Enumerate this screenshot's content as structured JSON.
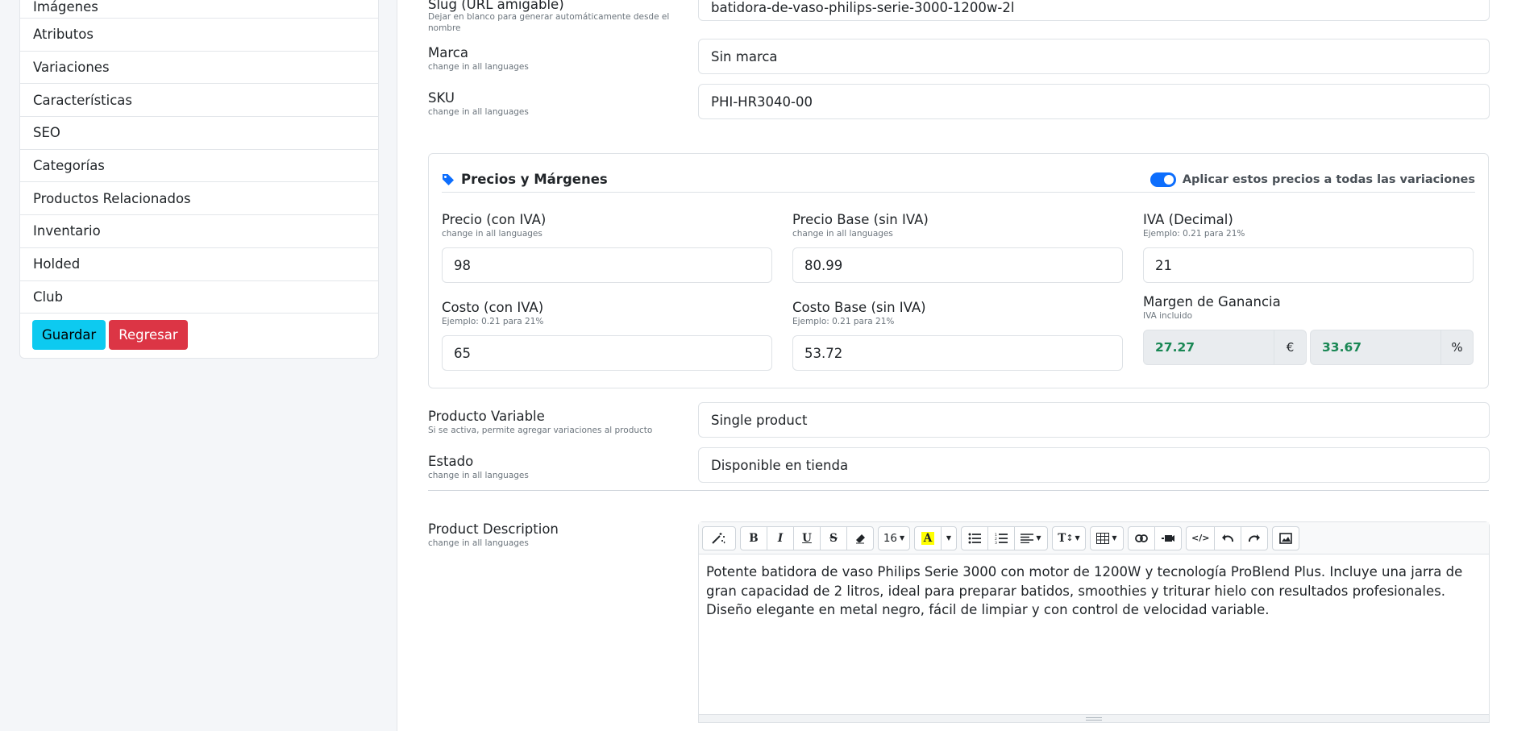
{
  "sidebar": {
    "items": [
      {
        "label": "Imágenes"
      },
      {
        "label": "Atributos"
      },
      {
        "label": "Variaciones"
      },
      {
        "label": "Características"
      },
      {
        "label": "SEO"
      },
      {
        "label": "Categorías"
      },
      {
        "label": "Productos Relacionados"
      },
      {
        "label": "Inventario"
      },
      {
        "label": "Holded"
      },
      {
        "label": "Club"
      }
    ],
    "save_label": "Guardar",
    "back_label": "Regresar"
  },
  "form": {
    "slug": {
      "label": "Slug (URL amigable)",
      "hint": "Dejar en blanco para generar automáticamente desde el nombre",
      "value": "batidora-de-vaso-philips-serie-3000-1200w-2l"
    },
    "brand": {
      "label": "Marca",
      "hint": "change in all languages",
      "value": "Sin marca"
    },
    "sku": {
      "label": "SKU",
      "hint": "change in all languages",
      "value": "PHI-HR3040-00"
    },
    "variable": {
      "label": "Producto Variable",
      "hint": "Si se activa, permite agregar variaciones al producto",
      "value": "Single product"
    },
    "status": {
      "label": "Estado",
      "hint": "change in all languages",
      "value": "Disponible en tienda"
    }
  },
  "prices": {
    "title": "Precios y Márgenes",
    "toggle_label": "Aplicar estos precios a todas las variaciones",
    "price_vat": {
      "label": "Precio (con IVA)",
      "hint": "change in all languages",
      "value": "98"
    },
    "price_base": {
      "label": "Precio Base (sin IVA)",
      "hint": "change in all languages",
      "value": "80.99"
    },
    "vat": {
      "label": "IVA (Decimal)",
      "hint": "Ejemplo: 0.21 para 21%",
      "value": "21"
    },
    "cost_vat": {
      "label": "Costo (con IVA)",
      "hint": "Ejemplo: 0.21 para 21%",
      "value": "65"
    },
    "cost_base": {
      "label": "Costo Base (sin IVA)",
      "hint": "Ejemplo: 0.21 para 21%",
      "value": "53.72"
    },
    "margin": {
      "label": "Margen de Ganancia",
      "hint": "IVA incluido",
      "amount": "27.27",
      "amount_unit": "€",
      "percent": "33.67",
      "percent_unit": "%"
    },
    "colors": {
      "accent": "#0d6efd",
      "margin_text": "#198754"
    }
  },
  "description": {
    "label": "Product Description",
    "hint": "change in all languages",
    "font_size": "16",
    "text": "Potente batidora de vaso Philips Serie 3000 con motor de 1200W y tecnología ProBlend Plus. Incluye una jarra de gran capacidad de 2 litros, ideal para preparar batidos, smoothies y triturar hielo con resultados profesionales. Diseño elegante en metal negro, fácil de limpiar y con control de velocidad variable."
  }
}
